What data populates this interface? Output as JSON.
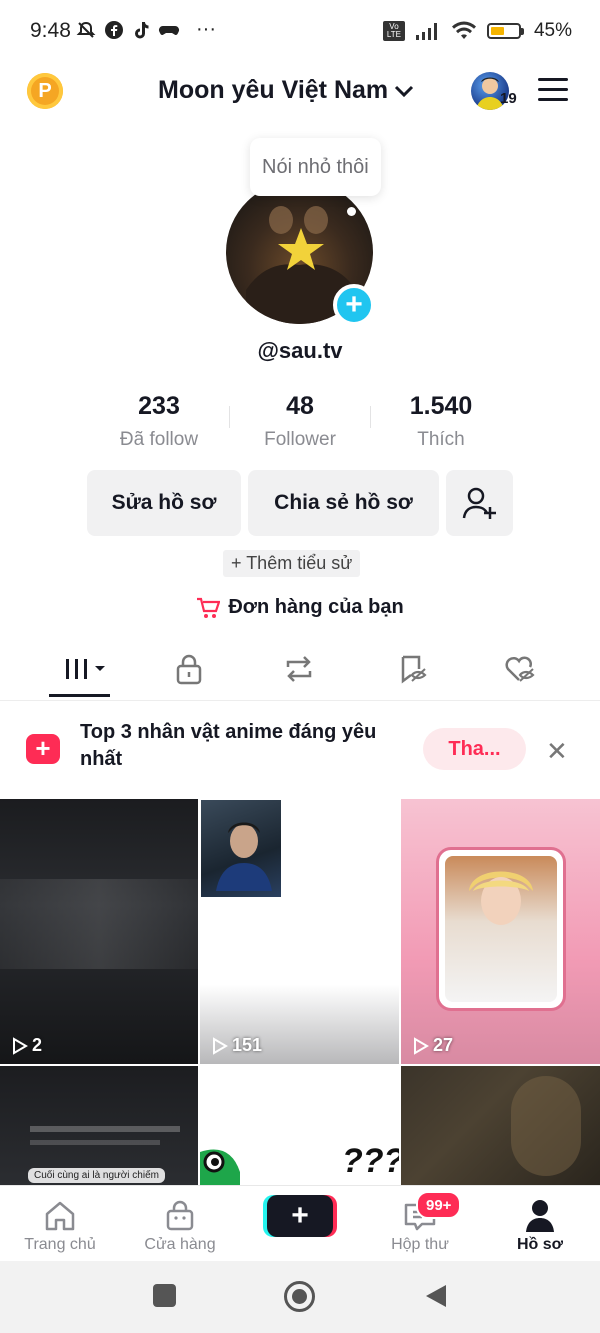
{
  "status_bar": {
    "time": "9:48",
    "more": "···",
    "network": "Vo LTE",
    "battery_percent": "45%",
    "battery_level": 0.45
  },
  "header": {
    "title": "Moon yêu Việt Nam",
    "notification_count": "19"
  },
  "profile": {
    "note": "Nói nhỏ thôi",
    "username": "@sau.tv",
    "stats": [
      {
        "value": "233",
        "label": "Đã follow"
      },
      {
        "value": "48",
        "label": "Follower"
      },
      {
        "value": "1.540",
        "label": "Thích"
      }
    ],
    "edit_button": "Sửa hồ sơ",
    "share_button": "Chia sẻ hồ sơ",
    "bio_chip": "+ Thêm tiểu sử",
    "orders_label": "Đơn hàng của bạn"
  },
  "banner": {
    "text": "Top 3 nhân vật anime đáng yêu nhất",
    "action": "Tha..."
  },
  "videos": [
    {
      "views": "2"
    },
    {
      "views": "151"
    },
    {
      "views": "27"
    },
    {
      "views": "",
      "caption": "Cuối cùng ai là người chiếm"
    },
    {
      "views": "",
      "caption": "???"
    },
    {
      "views": ""
    }
  ],
  "bottom_nav": {
    "items": [
      {
        "label": "Trang chủ",
        "icon": "home-icon"
      },
      {
        "label": "Cửa hàng",
        "icon": "shop-icon"
      },
      {
        "label": "",
        "icon": "plus-icon"
      },
      {
        "label": "Hộp thư",
        "icon": "inbox-icon"
      },
      {
        "label": "Hồ sơ",
        "icon": "profile-icon"
      }
    ],
    "inbox_badge": "99+"
  },
  "colors": {
    "accent": "#fe2c55",
    "cyan": "#25f4ee",
    "badge_blue": "#20c5f0"
  }
}
